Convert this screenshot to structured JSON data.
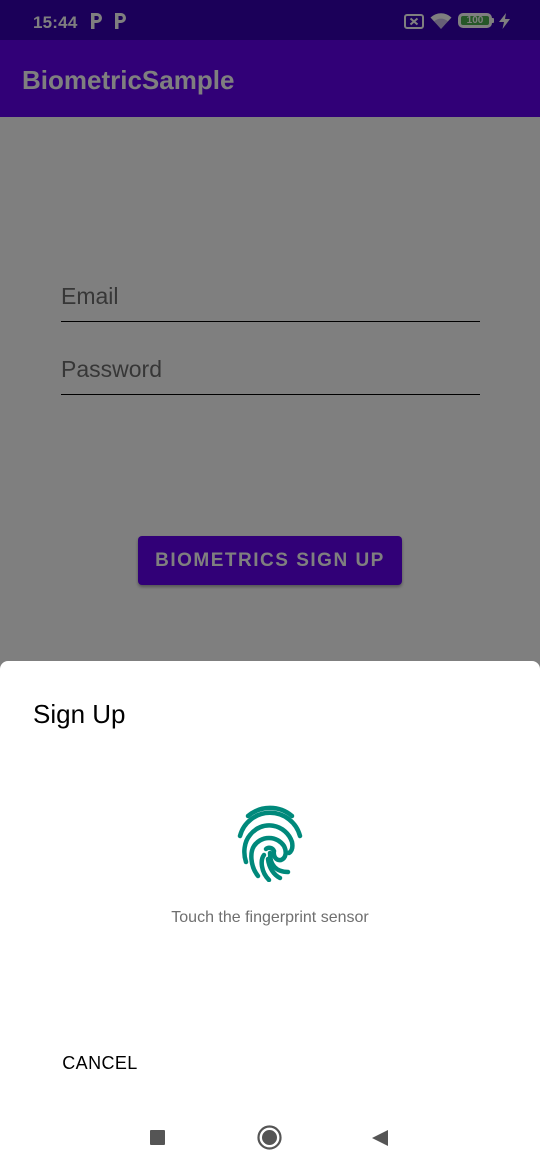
{
  "status_bar": {
    "time": "15:44",
    "notification_icons": [
      "parking-p-icon",
      "parking-p-icon"
    ],
    "right_icons": [
      "screencast-off-icon",
      "wifi-icon",
      "battery-icon",
      "charging-bolt-icon"
    ],
    "battery_level": "100"
  },
  "app_bar": {
    "title": "BiometricSample"
  },
  "form": {
    "email_placeholder": "Email",
    "password_placeholder": "Password",
    "signup_button_label": "BIOMETRICS SIGN UP"
  },
  "dialog": {
    "title": "Sign Up",
    "icon": "fingerprint-icon",
    "description": "Touch the fingerprint sensor",
    "cancel_label": "CANCEL"
  },
  "nav_bar": {
    "buttons": [
      "recents-button",
      "home-button",
      "back-button"
    ]
  },
  "colors": {
    "primary": "#6200ee",
    "primary_dark": "#3700b3",
    "fingerprint": "#00897b",
    "battery": "#4caf50"
  }
}
